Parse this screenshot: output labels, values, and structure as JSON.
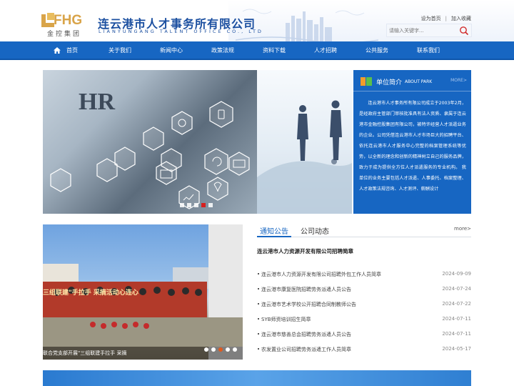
{
  "header": {
    "logo_letters": "FHG",
    "logo_sub": "金控集团",
    "site_name": "连云港市人才事务所有限公司",
    "site_name_en": "LIANYUNGANG TALENT OFFICE CO., LTD",
    "toplinks": {
      "home": "设为首页",
      "separator": "|",
      "favorite": "加入收藏"
    },
    "search": {
      "placeholder": "请输入关键字...",
      "icon": "search-icon"
    }
  },
  "nav": {
    "home_icon": "home-icon",
    "items": [
      "首页",
      "关于我们",
      "新闻中心",
      "政策法规",
      "资料下载",
      "人才招聘",
      "公共服务",
      "联系我们"
    ]
  },
  "banner": {
    "overlay_text": "HR",
    "slide_count": 5,
    "active_slide": 4
  },
  "intro": {
    "icon": "about-park-icon",
    "title": "单位简介",
    "title_en": "ABOUT PARK",
    "more": "MORE>",
    "text": "连云港市人才事务所有限公司成立于2003年2月，是经政府主管部门审核批准具有法人资质、隶属于连云港市金融控股集团有限公司，被特许经营人才派遣业务的企业。公司凭借连云港市人才市场巨大的招聘平台、依托连云港市人才服务中心完整的档案管理系统等优势，以全新的理念和创新的精神树立自己的服务品牌，致力于成为提供全方位人才派遣服务的专业机构。 我单位的业务主要包括人才派遣、人事委托、档案整理、人才政策法规咨询、人才测评、薪酬设计"
  },
  "photo": {
    "banner_text": "三组联建\"手拉手 采摘活动心连心",
    "caption": "联合党支部开展\"三组联建手拉手 采摘",
    "slide_count": 5,
    "active_slide": 2
  },
  "news": {
    "tabs": [
      "通知公告",
      "公司动态"
    ],
    "more": "more>",
    "headline": "连云港市人力资源开发有限公司招聘简章",
    "items": [
      {
        "title": "连云港市人力资源开发有限公司招聘外包工作人员简章",
        "date": "2024-09-09"
      },
      {
        "title": "连云港市康复医院招聘劳务派遣人员公告",
        "date": "2024-07-24"
      },
      {
        "title": "连云港市艺术学校公开招聘合同制教师公告",
        "date": "2024-07-22"
      },
      {
        "title": "SYB师资培训招生简章",
        "date": "2024-07-11"
      },
      {
        "title": "连云港市慈善总会招聘劳务派遣人员公告",
        "date": "2024-07-11"
      },
      {
        "title": "农发置业公司招聘劳务派遣工作人员简章",
        "date": "2024-05-17"
      }
    ]
  },
  "colors": {
    "primary": "#1766c2",
    "gold": "#d9a449",
    "active_dot": "#d62020"
  }
}
